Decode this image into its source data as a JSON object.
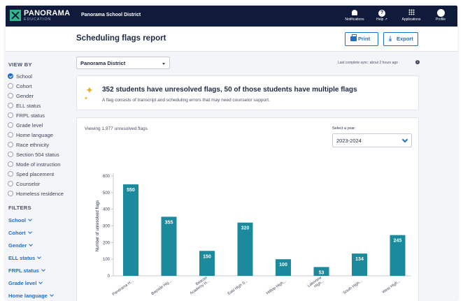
{
  "nav": {
    "brand": "PANORAMA",
    "brand_sub": "EDUCATION",
    "district": "Panorama School District",
    "notifications": "Notifications",
    "help": "Help",
    "help_ext": "↗",
    "applications": "Applications",
    "profile": "Profile"
  },
  "header": {
    "title": "Scheduling flags report",
    "print_label": "Print",
    "export_label": "Export"
  },
  "sidebar": {
    "view_by_heading": "VIEW BY",
    "view_by": [
      {
        "label": "School",
        "selected": true
      },
      {
        "label": "Cohort",
        "selected": false
      },
      {
        "label": "Gender",
        "selected": false
      },
      {
        "label": "ELL status",
        "selected": false
      },
      {
        "label": "FRPL status",
        "selected": false
      },
      {
        "label": "Grade level",
        "selected": false
      },
      {
        "label": "Home language",
        "selected": false
      },
      {
        "label": "Race ethnicity",
        "selected": false
      },
      {
        "label": "Section 504 status",
        "selected": false
      },
      {
        "label": "Mode of instruction",
        "selected": false
      },
      {
        "label": "Sped placement",
        "selected": false
      },
      {
        "label": "Counselor",
        "selected": false
      },
      {
        "label": "Homeless residence",
        "selected": false
      }
    ],
    "filters_heading": "FILTERS",
    "filters": [
      "School",
      "Cohort",
      "Gender",
      "ELL status",
      "FRPL status",
      "Grade level",
      "Home language"
    ]
  },
  "main": {
    "district_select": "Panorama District",
    "sync_text": "Last complete sync: about 2 hours ago",
    "summary_title": "352 students have unresolved flags, 50 of those students have multiple flags",
    "summary_desc": "A flag consists of transcript and scheduling errors that may need counselor support.",
    "viewing": "Viewing 1,977 unresolved flags",
    "year_label": "Select a year:",
    "year_value": "2023-2024"
  },
  "colors": {
    "bar": "#1a8a9c",
    "accent": "#1f6ec9",
    "nav_bg": "#101a3b"
  },
  "chart_data": {
    "type": "bar",
    "categories": [
      "Panorama H...",
      "Bayside Hig...",
      "Beacon Academy H...",
      "East High S...",
      "Hilltop High...",
      "Lakeview High...",
      "South High...",
      "West High..."
    ],
    "category_lines": [
      [
        "Panorama H..."
      ],
      [
        "Bayside Hig..."
      ],
      [
        "Beacon",
        "Academy H..."
      ],
      [
        "East High S..."
      ],
      [
        "Hilltop High..."
      ],
      [
        "Lakeview",
        "High..."
      ],
      [
        "South High..."
      ],
      [
        "West High..."
      ]
    ],
    "values": [
      550,
      355,
      150,
      320,
      100,
      53,
      134,
      245
    ],
    "ylabel": "Number of unresolved flags",
    "ylim": [
      0,
      600
    ],
    "yticks": [
      0,
      100,
      200,
      300,
      400,
      500,
      600
    ],
    "grid": false
  }
}
